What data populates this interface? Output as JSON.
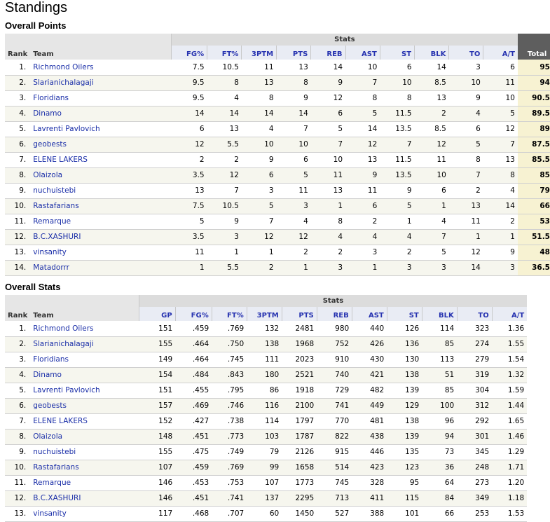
{
  "page_title": "Standings",
  "points": {
    "title": "Overall Points",
    "group_label": "Stats",
    "columns": [
      "Rank",
      "Team",
      "FG%",
      "FT%",
      "3PTM",
      "PTS",
      "REB",
      "AST",
      "ST",
      "BLK",
      "TO",
      "A/T",
      "Total"
    ],
    "rows": [
      [
        "1.",
        "Richmond Oilers",
        "7.5",
        "10.5",
        "11",
        "13",
        "14",
        "10",
        "6",
        "14",
        "3",
        "6",
        "95"
      ],
      [
        "2.",
        "Slarianichalagaji",
        "9.5",
        "8",
        "13",
        "8",
        "9",
        "7",
        "10",
        "8.5",
        "10",
        "11",
        "94"
      ],
      [
        "3.",
        "Floridians",
        "9.5",
        "4",
        "8",
        "9",
        "12",
        "8",
        "8",
        "13",
        "9",
        "10",
        "90.5"
      ],
      [
        "4.",
        "Dinamo",
        "14",
        "14",
        "14",
        "14",
        "6",
        "5",
        "11.5",
        "2",
        "4",
        "5",
        "89.5"
      ],
      [
        "5.",
        "Lavrenti Pavlovich",
        "6",
        "13",
        "4",
        "7",
        "5",
        "14",
        "13.5",
        "8.5",
        "6",
        "12",
        "89"
      ],
      [
        "6.",
        "geobests",
        "12",
        "5.5",
        "10",
        "10",
        "7",
        "12",
        "7",
        "12",
        "5",
        "7",
        "87.5"
      ],
      [
        "7.",
        "ELENE LAKERS",
        "2",
        "2",
        "9",
        "6",
        "10",
        "13",
        "11.5",
        "11",
        "8",
        "13",
        "85.5"
      ],
      [
        "8.",
        "Olaizola",
        "3.5",
        "12",
        "6",
        "5",
        "11",
        "9",
        "13.5",
        "10",
        "7",
        "8",
        "85"
      ],
      [
        "9.",
        "nuchuistebi",
        "13",
        "7",
        "3",
        "11",
        "13",
        "11",
        "9",
        "6",
        "2",
        "4",
        "79"
      ],
      [
        "10.",
        "Rastafarians",
        "7.5",
        "10.5",
        "5",
        "3",
        "1",
        "6",
        "5",
        "1",
        "13",
        "14",
        "66"
      ],
      [
        "11.",
        "Remarque",
        "5",
        "9",
        "7",
        "4",
        "8",
        "2",
        "1",
        "4",
        "11",
        "2",
        "53"
      ],
      [
        "12.",
        "B.C.XASHURI",
        "3.5",
        "3",
        "12",
        "12",
        "4",
        "4",
        "4",
        "7",
        "1",
        "1",
        "51.5"
      ],
      [
        "13.",
        "vinsanity",
        "11",
        "1",
        "1",
        "2",
        "2",
        "3",
        "2",
        "5",
        "12",
        "9",
        "48"
      ],
      [
        "14.",
        "Matadorrr",
        "1",
        "5.5",
        "2",
        "1",
        "3",
        "1",
        "3",
        "3",
        "14",
        "3",
        "36.5"
      ]
    ]
  },
  "stats": {
    "title": "Overall Stats",
    "group_label": "Stats",
    "columns": [
      "Rank",
      "Team",
      "GP",
      "FG%",
      "FT%",
      "3PTM",
      "PTS",
      "REB",
      "AST",
      "ST",
      "BLK",
      "TO",
      "A/T"
    ],
    "rows": [
      [
        "1.",
        "Richmond Oilers",
        "151",
        ".459",
        ".769",
        "132",
        "2481",
        "980",
        "440",
        "126",
        "114",
        "323",
        "1.36"
      ],
      [
        "2.",
        "Slarianichalagaji",
        "155",
        ".464",
        ".750",
        "138",
        "1968",
        "752",
        "426",
        "136",
        "85",
        "274",
        "1.55"
      ],
      [
        "3.",
        "Floridians",
        "149",
        ".464",
        ".745",
        "111",
        "2023",
        "910",
        "430",
        "130",
        "113",
        "279",
        "1.54"
      ],
      [
        "4.",
        "Dinamo",
        "154",
        ".484",
        ".843",
        "180",
        "2521",
        "740",
        "421",
        "138",
        "51",
        "319",
        "1.32"
      ],
      [
        "5.",
        "Lavrenti Pavlovich",
        "151",
        ".455",
        ".795",
        "86",
        "1918",
        "729",
        "482",
        "139",
        "85",
        "304",
        "1.59"
      ],
      [
        "6.",
        "geobests",
        "157",
        ".469",
        ".746",
        "116",
        "2100",
        "741",
        "449",
        "129",
        "100",
        "312",
        "1.44"
      ],
      [
        "7.",
        "ELENE LAKERS",
        "152",
        ".427",
        ".738",
        "114",
        "1797",
        "770",
        "481",
        "138",
        "96",
        "292",
        "1.65"
      ],
      [
        "8.",
        "Olaizola",
        "148",
        ".451",
        ".773",
        "103",
        "1787",
        "822",
        "438",
        "139",
        "94",
        "301",
        "1.46"
      ],
      [
        "9.",
        "nuchuistebi",
        "155",
        ".475",
        ".749",
        "79",
        "2126",
        "915",
        "446",
        "135",
        "73",
        "345",
        "1.29"
      ],
      [
        "10.",
        "Rastafarians",
        "107",
        ".459",
        ".769",
        "99",
        "1658",
        "514",
        "423",
        "123",
        "36",
        "248",
        "1.71"
      ],
      [
        "11.",
        "Remarque",
        "146",
        ".453",
        ".753",
        "107",
        "1773",
        "745",
        "328",
        "95",
        "64",
        "273",
        "1.20"
      ],
      [
        "12.",
        "B.C.XASHURI",
        "146",
        ".451",
        ".741",
        "137",
        "2295",
        "713",
        "411",
        "115",
        "84",
        "349",
        "1.18"
      ],
      [
        "13.",
        "vinsanity",
        "117",
        ".468",
        ".707",
        "60",
        "1450",
        "527",
        "388",
        "101",
        "66",
        "253",
        "1.53"
      ]
    ]
  }
}
